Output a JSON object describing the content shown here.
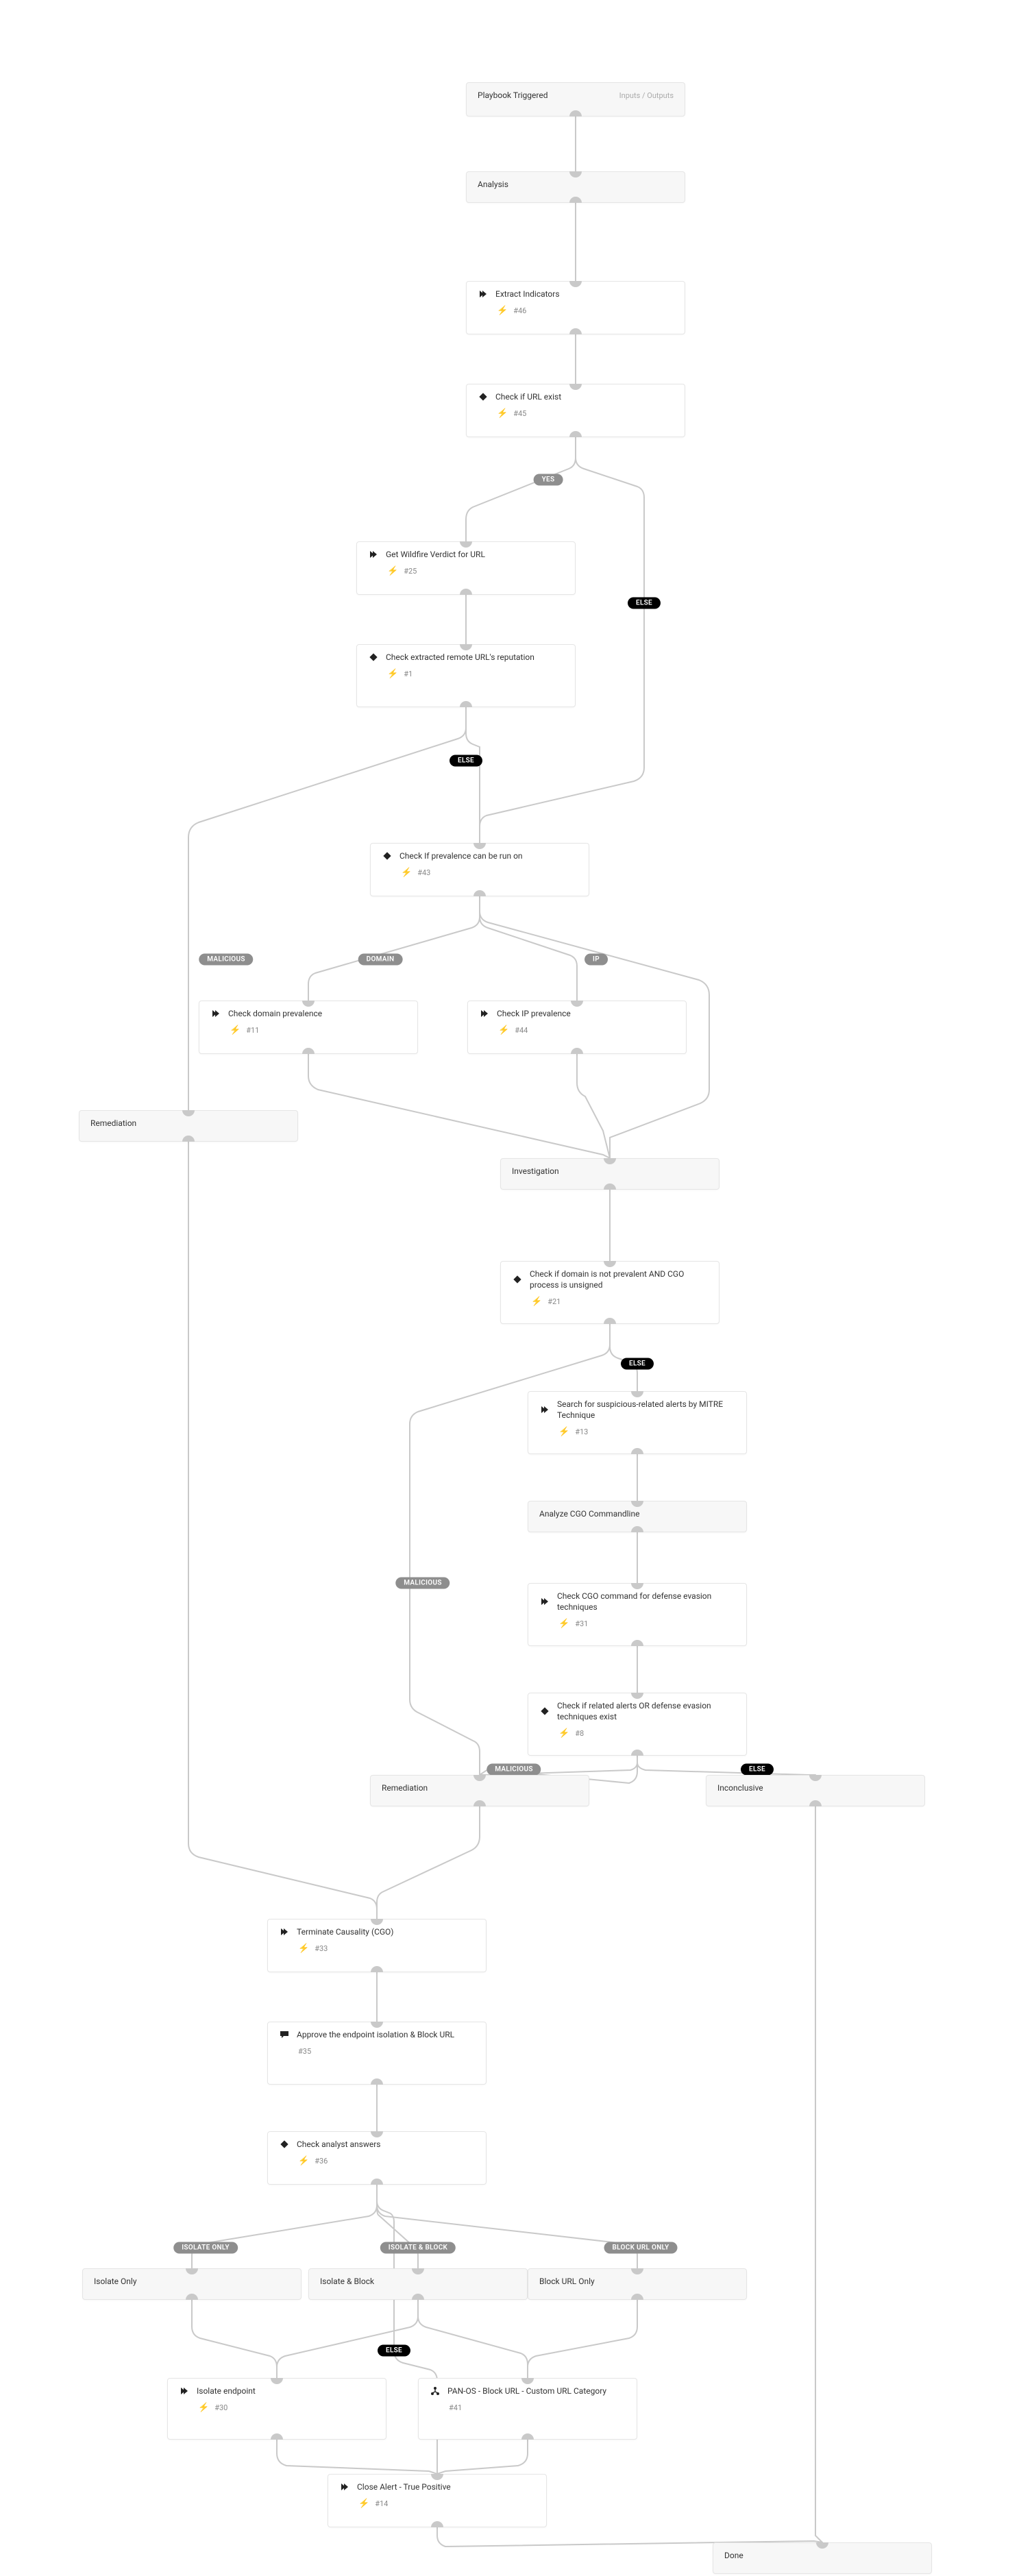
{
  "start": {
    "label": "Playbook Triggered",
    "io": "Inputs / Outputs"
  },
  "sections": {
    "analysis": "Analysis",
    "investigation": "Investigation",
    "remediation1": "Remediation",
    "remediation2": "Remediation",
    "inconclusive": "Inconclusive",
    "isolate_only": "Isolate Only",
    "isolate_block": "Isolate & Block",
    "block_url": "Block URL Only",
    "analyze_cmd": "Analyze CGO Commandline",
    "done": "Done"
  },
  "tasks": {
    "extract": {
      "title": "Extract Indicators",
      "id": "#46"
    },
    "check_url": {
      "title": "Check if URL exist",
      "id": "#45"
    },
    "wildfire": {
      "title": "Get Wildfire Verdict for URL",
      "id": "#25"
    },
    "check_rep": {
      "title": "Check extracted remote URL's reputation",
      "id": "#1"
    },
    "check_prev": {
      "title": "Check If prevalence can be run on",
      "id": "#43"
    },
    "dom_prev": {
      "title": "Check domain prevalence",
      "id": "#11"
    },
    "ip_prev": {
      "title": "Check IP prevalence",
      "id": "#44"
    },
    "dom_not_prev": {
      "title": "Check if domain is not prevalent AND CGO process is unsigned",
      "id": "#21"
    },
    "search_mitre": {
      "title": "Search for suspicious-related alerts by MITRE Technique",
      "id": "#13"
    },
    "check_evasion": {
      "title": "Check CGO command for defense evasion techniques",
      "id": "#31"
    },
    "check_related": {
      "title": "Check if related alerts OR defense evasion techniques exist",
      "id": "#8"
    },
    "terminate": {
      "title": "Terminate Causality (CGO)",
      "id": "#33"
    },
    "approve": {
      "title": "Approve the endpoint isolation & Block URL",
      "id": "#35"
    },
    "check_ans": {
      "title": "Check analyst answers",
      "id": "#36"
    },
    "isolate_ep": {
      "title": "Isolate endpoint",
      "id": "#30"
    },
    "panos": {
      "title": "PAN-OS - Block URL - Custom URL Category",
      "id": "#41"
    },
    "close_tp": {
      "title": "Close Alert - True Positive",
      "id": "#14"
    }
  },
  "pills": {
    "yes": "YES",
    "else": "ELSE",
    "malicious": "MALICIOUS",
    "domain": "DOMAIN",
    "ip": "IP",
    "iso_only": "ISOLATE ONLY",
    "iso_block": "ISOLATE & BLOCK",
    "block_only": "BLOCK URL ONLY"
  },
  "chart_data": {
    "type": "flowchart",
    "nodes": [
      {
        "id": "start",
        "type": "start",
        "label": "Playbook Triggered"
      },
      {
        "id": "analysis",
        "type": "section",
        "label": "Analysis"
      },
      {
        "id": "extract",
        "type": "task",
        "label": "Extract Indicators",
        "mark": "#46",
        "icon": "chevron"
      },
      {
        "id": "check_url",
        "type": "condition",
        "label": "Check if URL exist",
        "mark": "#45",
        "icon": "diamond"
      },
      {
        "id": "wildfire",
        "type": "task",
        "label": "Get Wildfire Verdict for URL",
        "mark": "#25",
        "icon": "chevron"
      },
      {
        "id": "check_rep",
        "type": "condition",
        "label": "Check extracted remote URL's reputation",
        "mark": "#1",
        "icon": "diamond"
      },
      {
        "id": "check_prev",
        "type": "condition",
        "label": "Check If prevalence can be run on",
        "mark": "#43",
        "icon": "diamond"
      },
      {
        "id": "dom_prev",
        "type": "task",
        "label": "Check domain prevalence",
        "mark": "#11",
        "icon": "chevron"
      },
      {
        "id": "ip_prev",
        "type": "task",
        "label": "Check IP prevalence",
        "mark": "#44",
        "icon": "chevron"
      },
      {
        "id": "remediation1",
        "type": "section",
        "label": "Remediation"
      },
      {
        "id": "investigation",
        "type": "section",
        "label": "Investigation"
      },
      {
        "id": "dom_not_prev",
        "type": "condition",
        "label": "Check if domain is not prevalent AND CGO process is unsigned",
        "mark": "#21",
        "icon": "diamond"
      },
      {
        "id": "search_mitre",
        "type": "task",
        "label": "Search for suspicious-related alerts by MITRE Technique",
        "mark": "#13",
        "icon": "chevron"
      },
      {
        "id": "analyze_cmd",
        "type": "section",
        "label": "Analyze CGO Commandline"
      },
      {
        "id": "check_evasion",
        "type": "task",
        "label": "Check CGO command for defense evasion techniques",
        "mark": "#31",
        "icon": "chevron"
      },
      {
        "id": "check_related",
        "type": "condition",
        "label": "Check if related alerts OR defense evasion techniques exist",
        "mark": "#8",
        "icon": "diamond"
      },
      {
        "id": "remediation2",
        "type": "section",
        "label": "Remediation"
      },
      {
        "id": "inconclusive",
        "type": "section",
        "label": "Inconclusive"
      },
      {
        "id": "terminate",
        "type": "task",
        "label": "Terminate Causality (CGO)",
        "mark": "#33",
        "icon": "chevron"
      },
      {
        "id": "approve",
        "type": "task",
        "label": "Approve the endpoint isolation & Block URL",
        "mark": "#35",
        "icon": "chat"
      },
      {
        "id": "check_ans",
        "type": "condition",
        "label": "Check analyst answers",
        "mark": "#36",
        "icon": "diamond"
      },
      {
        "id": "isolate_only",
        "type": "section",
        "label": "Isolate Only"
      },
      {
        "id": "isolate_block",
        "type": "section",
        "label": "Isolate & Block"
      },
      {
        "id": "block_url",
        "type": "section",
        "label": "Block URL Only"
      },
      {
        "id": "isolate_ep",
        "type": "task",
        "label": "Isolate endpoint",
        "mark": "#30",
        "icon": "chevron"
      },
      {
        "id": "panos",
        "type": "task",
        "label": "PAN-OS - Block URL - Custom URL Category",
        "mark": "#41",
        "icon": "tree"
      },
      {
        "id": "close_tp",
        "type": "task",
        "label": "Close Alert - True Positive",
        "mark": "#14",
        "icon": "chevron"
      },
      {
        "id": "done",
        "type": "section",
        "label": "Done"
      }
    ],
    "edges": [
      {
        "from": "start",
        "to": "analysis"
      },
      {
        "from": "analysis",
        "to": "extract"
      },
      {
        "from": "extract",
        "to": "check_url"
      },
      {
        "from": "check_url",
        "to": "wildfire",
        "label": "YES"
      },
      {
        "from": "check_url",
        "to": "check_prev",
        "label": "ELSE"
      },
      {
        "from": "wildfire",
        "to": "check_rep"
      },
      {
        "from": "check_rep",
        "to": "check_prev",
        "label": "ELSE"
      },
      {
        "from": "check_rep",
        "to": "remediation1",
        "label": "MALICIOUS"
      },
      {
        "from": "check_prev",
        "to": "dom_prev",
        "label": "DOMAIN"
      },
      {
        "from": "check_prev",
        "to": "ip_prev",
        "label": "IP"
      },
      {
        "from": "check_prev",
        "to": "investigation",
        "label": "ELSE"
      },
      {
        "from": "dom_prev",
        "to": "investigation"
      },
      {
        "from": "ip_prev",
        "to": "investigation"
      },
      {
        "from": "investigation",
        "to": "dom_not_prev"
      },
      {
        "from": "dom_not_prev",
        "to": "search_mitre",
        "label": "ELSE"
      },
      {
        "from": "dom_not_prev",
        "to": "remediation2",
        "label": "MALICIOUS"
      },
      {
        "from": "search_mitre",
        "to": "analyze_cmd"
      },
      {
        "from": "analyze_cmd",
        "to": "check_evasion"
      },
      {
        "from": "check_evasion",
        "to": "check_related"
      },
      {
        "from": "check_related",
        "to": "remediation2",
        "label": "MALICIOUS"
      },
      {
        "from": "check_related",
        "to": "inconclusive",
        "label": "ELSE"
      },
      {
        "from": "remediation1",
        "to": "terminate"
      },
      {
        "from": "remediation2",
        "to": "terminate"
      },
      {
        "from": "terminate",
        "to": "approve"
      },
      {
        "from": "approve",
        "to": "check_ans"
      },
      {
        "from": "check_ans",
        "to": "isolate_only",
        "label": "ISOLATE ONLY"
      },
      {
        "from": "check_ans",
        "to": "isolate_block",
        "label": "ISOLATE & BLOCK"
      },
      {
        "from": "check_ans",
        "to": "block_url",
        "label": "BLOCK URL ONLY"
      },
      {
        "from": "check_ans",
        "to": "close_tp",
        "label": "ELSE"
      },
      {
        "from": "isolate_only",
        "to": "isolate_ep"
      },
      {
        "from": "isolate_block",
        "to": "isolate_ep"
      },
      {
        "from": "isolate_block",
        "to": "panos"
      },
      {
        "from": "block_url",
        "to": "panos"
      },
      {
        "from": "isolate_ep",
        "to": "close_tp"
      },
      {
        "from": "panos",
        "to": "close_tp"
      },
      {
        "from": "close_tp",
        "to": "done"
      },
      {
        "from": "inconclusive",
        "to": "done"
      }
    ]
  }
}
